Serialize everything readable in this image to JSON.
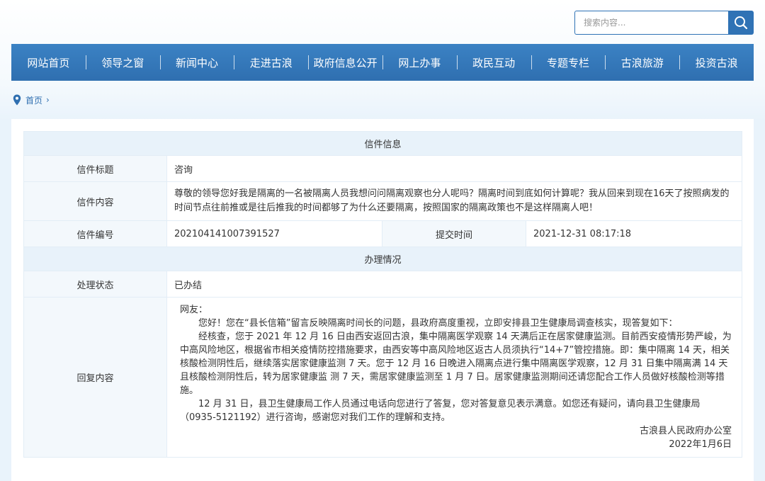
{
  "search": {
    "placeholder": "搜索内容..."
  },
  "nav": [
    "网站首页",
    "领导之窗",
    "新闻中心",
    "走进古浪",
    "政府信息公开",
    "网上办事",
    "政民互动",
    "专题专栏",
    "古浪旅游",
    "投资古浪"
  ],
  "breadcrumb": {
    "home": "首页",
    "separator": "›"
  },
  "letter": {
    "section_title": "信件信息",
    "title_label": "信件标题",
    "title_value": "咨询",
    "content_label": "信件内容",
    "content_value": "尊敬的领导您好我是隔离的一名被隔离人员我想问问隔离观察也分人呢吗？隔离时间到底如何计算呢？我从回来到现在16天了按照病发的时间节点往前推或是往后推我的时间都够了为什么还要隔离，按照国家的隔离政策也不是这样隔离人吧！",
    "number_label": "信件编号",
    "number_value": "202104141007391527",
    "submit_label": "提交时间",
    "submit_value": "2021-12-31 08:17:18"
  },
  "handling": {
    "section_title": "办理情况",
    "status_label": "处理状态",
    "status_value": "已办结",
    "reply_label": "回复内容",
    "reply_salutation": "网友：",
    "reply_p1": "您好！您在“县长信箱”留言反映隔离时间长的问题，县政府高度重视，立即安排县卫生健康局调查核实，现答复如下：",
    "reply_p2": "经核查，您于 2021 年 12 月 16 日由西安返回古浪，集中隔离医学观察 14 天满后正在居家健康监测。目前西安疫情形势严峻，为中高风险地区，根据省市相关疫情防控措施要求，由西安等中高风险地区返古人员须执行“14+7”管控措施。即：集中隔离 14 天，相关核酸检测阴性后，继续落实居家健康监测 7 天。您于 12 月 16 日晚进入隔离点进行集中隔离医学观察，12 月 31 日集中隔离满 14 天且核酸检测阴性后，转为居家健康监 测 7 天，需居家健康监测至 1 月 7 日。居家健康监测期间还请您配合工作人员做好核酸检测等措施。",
    "reply_p3": "12 月 31 日，县卫生健康局工作人员通过电话向您进行了答复，您对答复意见表示满意。如您还有疑问，请向县卫生健康局（0935-5121192）进行咨询，感谢您对我们工作的理解和支持。",
    "reply_signature": "古浪县人民政府办公室",
    "reply_date": "2022年1月6日"
  },
  "colors": {
    "brand": "#2f6fb0",
    "section_bg": "#e8f2fa",
    "label_bg": "#f3f8fc"
  }
}
